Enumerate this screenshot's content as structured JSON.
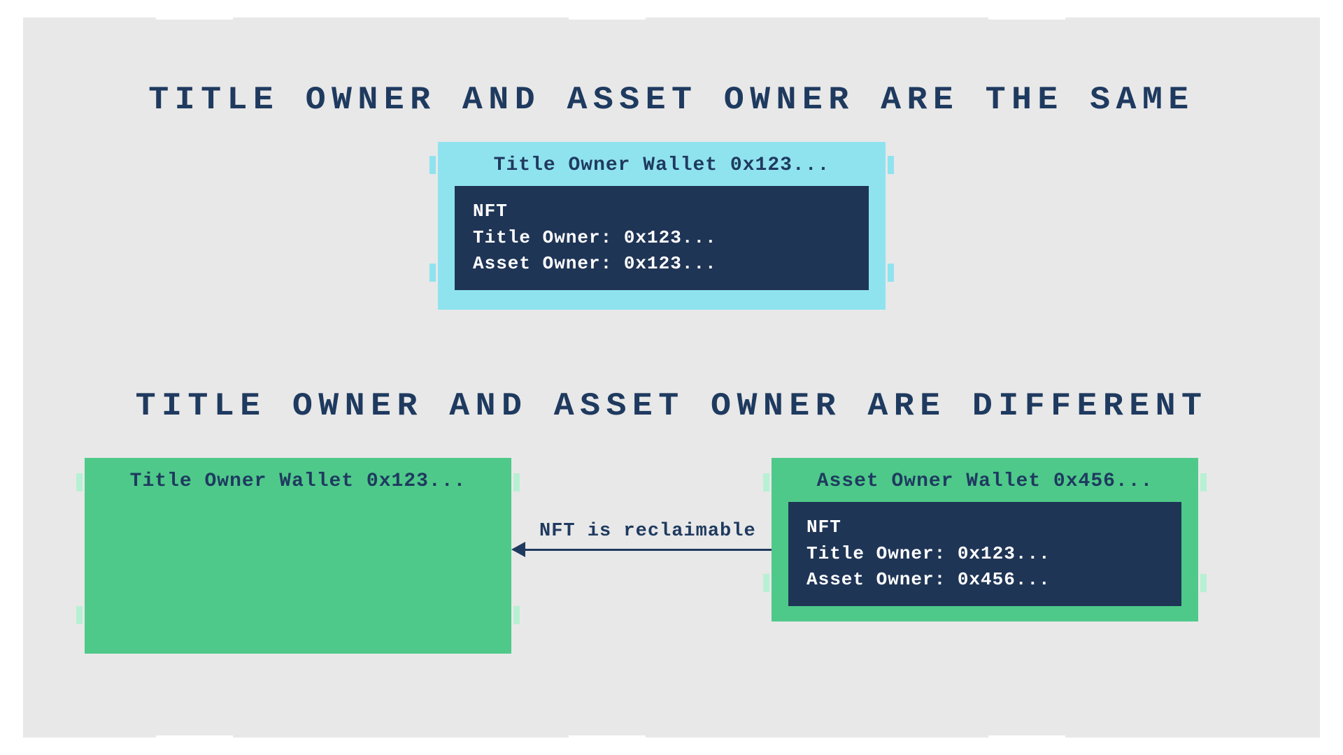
{
  "colors": {
    "bg_stage": "#e8e8e8",
    "navy": "#1f3a5f",
    "nft_bg": "#1f3556",
    "cyan": "#8fe3ef",
    "green": "#4ec98a"
  },
  "section_same": {
    "heading": "TITLE OWNER AND ASSET OWNER ARE THE SAME",
    "wallet": {
      "title": "Title Owner Wallet 0x123...",
      "nft": {
        "label": "NFT",
        "title_owner": "Title Owner: 0x123...",
        "asset_owner": "Asset Owner: 0x123..."
      }
    }
  },
  "section_diff": {
    "heading": "TITLE OWNER AND ASSET OWNER ARE DIFFERENT",
    "title_wallet": {
      "title": "Title Owner Wallet 0x123..."
    },
    "asset_wallet": {
      "title": "Asset Owner Wallet 0x456...",
      "nft": {
        "label": "NFT",
        "title_owner": "Title Owner: 0x123...",
        "asset_owner": "Asset Owner: 0x456..."
      }
    },
    "arrow_label": "NFT is reclaimable"
  }
}
